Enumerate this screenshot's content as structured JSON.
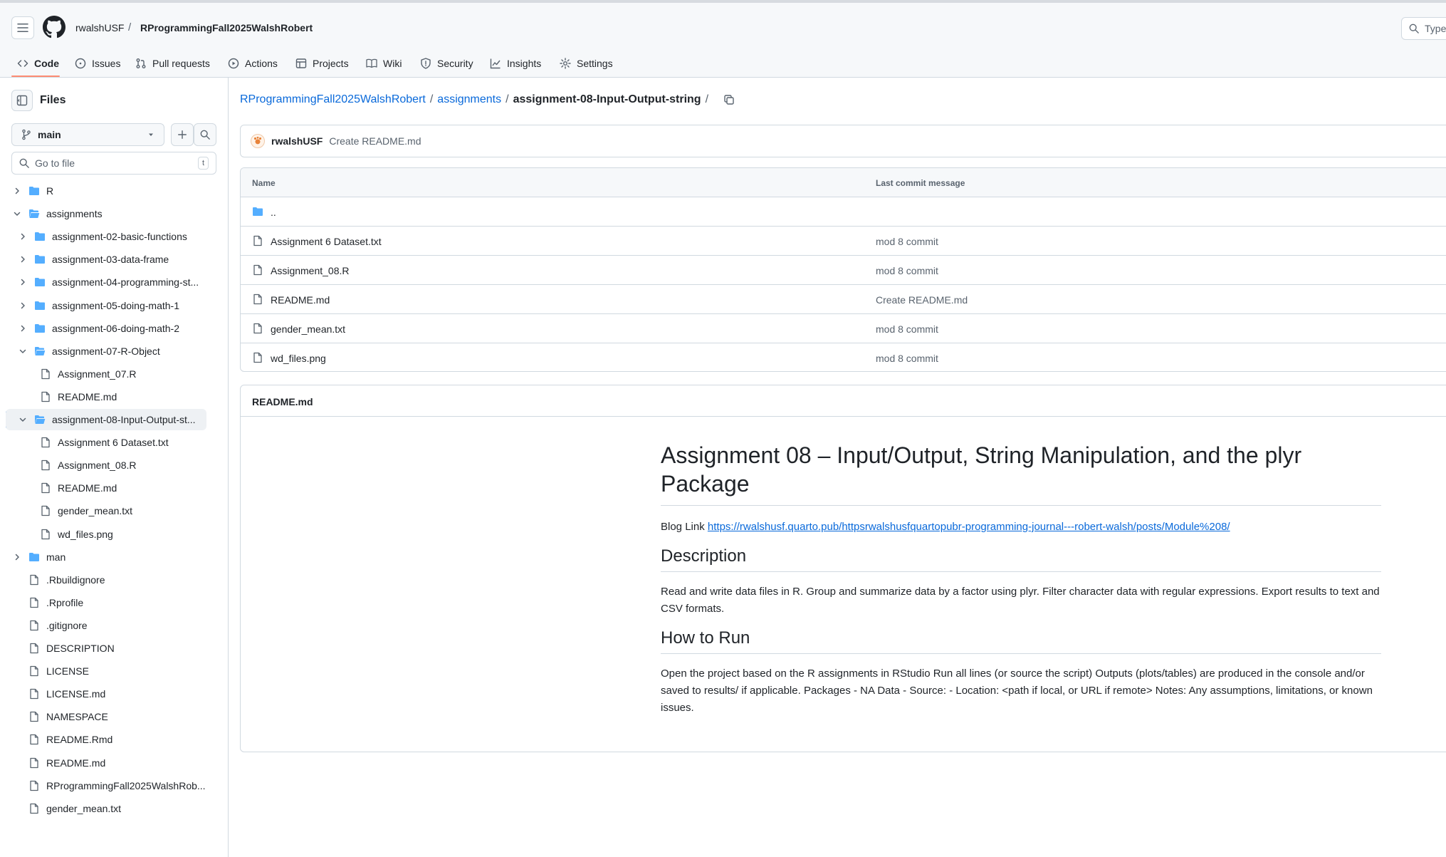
{
  "header": {
    "owner": "rwalshUSF",
    "separator": "/",
    "repo": "RProgrammingFall2025WalshRobert",
    "search_placeholder": "Type"
  },
  "nav": [
    {
      "label": "Code",
      "icon": "code-icon",
      "active": true
    },
    {
      "label": "Issues",
      "icon": "issue-opened-icon"
    },
    {
      "label": "Pull requests",
      "icon": "git-pull-request-icon"
    },
    {
      "label": "Actions",
      "icon": "play-icon"
    },
    {
      "label": "Projects",
      "icon": "table-icon"
    },
    {
      "label": "Wiki",
      "icon": "book-icon"
    },
    {
      "label": "Security",
      "icon": "shield-icon"
    },
    {
      "label": "Insights",
      "icon": "graph-icon"
    },
    {
      "label": "Settings",
      "icon": "gear-icon"
    }
  ],
  "sidebar": {
    "title": "Files",
    "branch": "main",
    "goto_placeholder": "Go to file",
    "goto_shortcut": "t",
    "tree": [
      {
        "label": "R",
        "type": "folder",
        "expanded": false,
        "depth": 0
      },
      {
        "label": "assignments",
        "type": "folder",
        "expanded": true,
        "depth": 0
      },
      {
        "label": "assignment-02-basic-functions",
        "type": "folder",
        "expanded": false,
        "depth": 1
      },
      {
        "label": "assignment-03-data-frame",
        "type": "folder",
        "expanded": false,
        "depth": 1
      },
      {
        "label": "assignment-04-programming-st...",
        "type": "folder",
        "expanded": false,
        "depth": 1
      },
      {
        "label": "assignment-05-doing-math-1",
        "type": "folder",
        "expanded": false,
        "depth": 1
      },
      {
        "label": "assignment-06-doing-math-2",
        "type": "folder",
        "expanded": false,
        "depth": 1
      },
      {
        "label": "assignment-07-R-Object",
        "type": "folder",
        "expanded": true,
        "depth": 1
      },
      {
        "label": "Assignment_07.R",
        "type": "file",
        "depth": 2
      },
      {
        "label": "README.md",
        "type": "file",
        "depth": 2
      },
      {
        "label": "assignment-08-Input-Output-st...",
        "type": "folder",
        "expanded": true,
        "depth": 1,
        "selected": true
      },
      {
        "label": "Assignment 6 Dataset.txt",
        "type": "file",
        "depth": 2
      },
      {
        "label": "Assignment_08.R",
        "type": "file",
        "depth": 2
      },
      {
        "label": "README.md",
        "type": "file",
        "depth": 2
      },
      {
        "label": "gender_mean.txt",
        "type": "file",
        "depth": 2
      },
      {
        "label": "wd_files.png",
        "type": "file",
        "depth": 2
      },
      {
        "label": "man",
        "type": "folder",
        "expanded": false,
        "depth": 0
      },
      {
        "label": ".Rbuildignore",
        "type": "file",
        "depth": 0
      },
      {
        "label": ".Rprofile",
        "type": "file",
        "depth": 0
      },
      {
        "label": ".gitignore",
        "type": "file",
        "depth": 0
      },
      {
        "label": "DESCRIPTION",
        "type": "file",
        "depth": 0
      },
      {
        "label": "LICENSE",
        "type": "file",
        "depth": 0
      },
      {
        "label": "LICENSE.md",
        "type": "file",
        "depth": 0
      },
      {
        "label": "NAMESPACE",
        "type": "file",
        "depth": 0
      },
      {
        "label": "README.Rmd",
        "type": "file",
        "depth": 0
      },
      {
        "label": "README.md",
        "type": "file",
        "depth": 0
      },
      {
        "label": "RProgrammingFall2025WalshRob...",
        "type": "file",
        "depth": 0
      },
      {
        "label": "gender_mean.txt",
        "type": "file",
        "depth": 0
      }
    ]
  },
  "main": {
    "breadcrumb": {
      "repo": "RProgrammingFall2025WalshRobert",
      "folder": "assignments",
      "current": "assignment-08-Input-Output-string",
      "sep": "/"
    },
    "commit": {
      "user": "rwalshUSF",
      "message": "Create README.md"
    },
    "table": {
      "headers": {
        "name": "Name",
        "message": "Last commit message"
      },
      "parent": "..",
      "rows": [
        {
          "name": "Assignment 6 Dataset.txt",
          "message": "mod 8 commit"
        },
        {
          "name": "Assignment_08.R",
          "message": "mod 8 commit"
        },
        {
          "name": "README.md",
          "message": "Create README.md"
        },
        {
          "name": "gender_mean.txt",
          "message": "mod 8 commit"
        },
        {
          "name": "wd_files.png",
          "message": "mod 8 commit"
        }
      ]
    },
    "readme": {
      "label": "README.md",
      "h1": "Assignment 08 – Input/Output, String Manipulation, and the plyr Package",
      "blog_prefix": "Blog Link",
      "blog_url": "https://rwalshusf.quarto.pub/httpsrwalshusfquartopubr-programming-journal---robert-walsh/posts/Module%208/",
      "h2_description": "Description",
      "description": "Read and write data files in R. Group and summarize data by a factor using plyr. Filter character data with regular expressions. Export results to text and CSV formats.",
      "h2_run": "How to Run",
      "run_text": "Open the project based on the R assignments in RStudio Run all lines (or source the script) Outputs (plots/tables) are produced in the console and/or saved to results/ if applicable. Packages - NA Data - Source: - Location: <path if local, or URL if remote> Notes: Any assumptions, limitations, or known issues."
    }
  },
  "colors": {
    "accent": "#0969da",
    "folder": "#54aeff",
    "underline": "#fd8c73",
    "border": "#d1d9e0"
  }
}
